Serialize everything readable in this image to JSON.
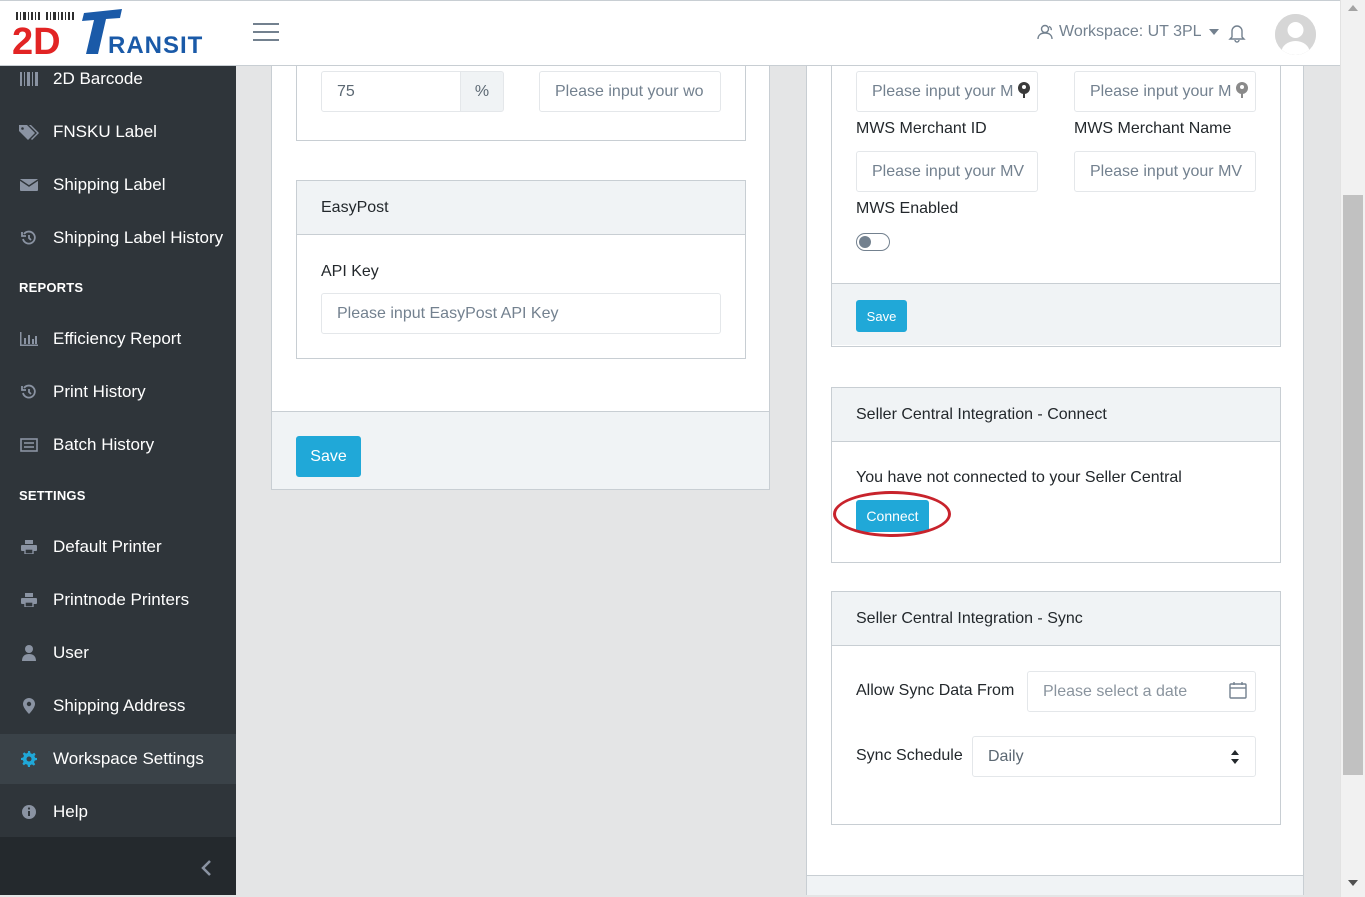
{
  "header": {
    "logo_text": "2DTRANSIT",
    "workspace_label": "Workspace: UT 3PL"
  },
  "sidebar": {
    "items": [
      {
        "label": "2D Barcode",
        "icon": "barcode-icon"
      },
      {
        "label": "FNSKU Label",
        "icon": "tags-icon"
      },
      {
        "label": "Shipping Label",
        "icon": "envelope-icon"
      },
      {
        "label": "Shipping Label History",
        "icon": "history-icon"
      },
      {
        "label": "Efficiency Report",
        "icon": "bar-chart-icon"
      },
      {
        "label": "Print History",
        "icon": "history-icon"
      },
      {
        "label": "Batch History",
        "icon": "list-icon"
      },
      {
        "label": "Default Printer",
        "icon": "printer-icon"
      },
      {
        "label": "Printnode Printers",
        "icon": "printer-icon"
      },
      {
        "label": "User",
        "icon": "user-icon"
      },
      {
        "label": "Shipping Address",
        "icon": "map-pin-icon"
      },
      {
        "label": "Workspace Settings",
        "icon": "gear-icon"
      },
      {
        "label": "Help",
        "icon": "info-icon"
      }
    ],
    "sections": {
      "reports": "REPORTS",
      "settings": "SETTINGS"
    },
    "active": "Workspace Settings"
  },
  "left_column": {
    "percent_value": "75",
    "percent_addon": "%",
    "work_placeholder": "Please input your wo",
    "easypost": {
      "title": "EasyPost",
      "api_key_label": "API Key",
      "api_key_placeholder": "Please input EasyPost API Key"
    },
    "save_label": "Save"
  },
  "right_column": {
    "mws": {
      "top_left_placeholder": "Please input your M",
      "top_right_placeholder": "Please input your M",
      "merchant_id_label": "MWS Merchant ID",
      "merchant_id_placeholder": "Please input your MV",
      "merchant_name_label": "MWS Merchant Name",
      "merchant_name_placeholder": "Please input your MV",
      "enabled_label": "MWS Enabled",
      "enabled": false,
      "save_label": "Save"
    },
    "connect": {
      "title": "Seller Central Integration - Connect",
      "message": "You have not connected to your Seller Central",
      "button_label": "Connect"
    },
    "sync": {
      "title": "Seller Central Integration - Sync",
      "allow_from_label": "Allow Sync Data From",
      "date_placeholder": "Please select a date",
      "schedule_label": "Sync Schedule",
      "schedule_value": "Daily"
    }
  },
  "colors": {
    "primary": "#20a8d8",
    "sidebar_bg": "#2f353a",
    "highlight_oval": "#c8232c"
  }
}
